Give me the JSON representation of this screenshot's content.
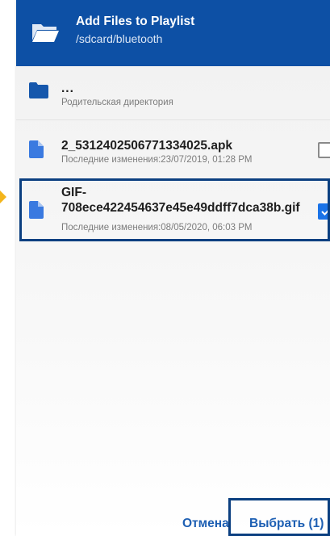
{
  "header": {
    "title": "Add Files to Playlist",
    "path": "/sdcard/bluetooth",
    "icon": "folder-open-icon",
    "color": "#0d50a5"
  },
  "parent_dir": {
    "name": "...",
    "subtitle": "Родительская директория",
    "icon": "folder-icon"
  },
  "files": [
    {
      "name": "2_5312402506771334025.apk",
      "modified": "Последние изменения:23/07/2019, 01:28 PM",
      "checked": false,
      "icon": "file-icon"
    },
    {
      "name": "GIF-708ece422454637e45e49ddff7dca38b.gif",
      "modified": "Последние изменения:08/05/2020, 06:03 PM",
      "checked": true,
      "icon": "file-icon"
    }
  ],
  "buttons": {
    "cancel": "Отмена",
    "select": "Выбрать (1)"
  },
  "accent_color": "#1a73e8",
  "highlight_color": "#0b3f80"
}
